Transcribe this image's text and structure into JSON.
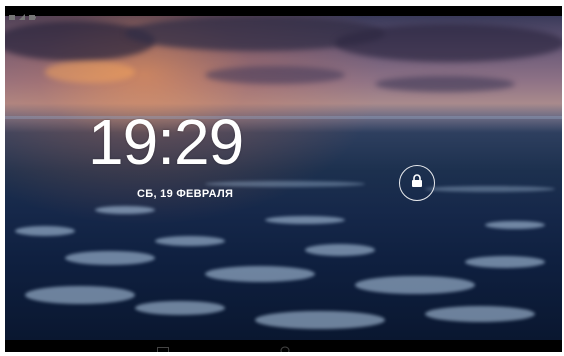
{
  "lockscreen": {
    "time": "19:29",
    "date": "СБ, 19 ФЕВРАЛЯ"
  },
  "icons": {
    "status": [
      "notification-icon",
      "signal-icon",
      "battery-icon"
    ],
    "unlock": "lock-icon",
    "nav": [
      "recent-apps-icon",
      "home-icon"
    ]
  },
  "colors": {
    "text": "#ffffff",
    "bars": "#000000"
  }
}
